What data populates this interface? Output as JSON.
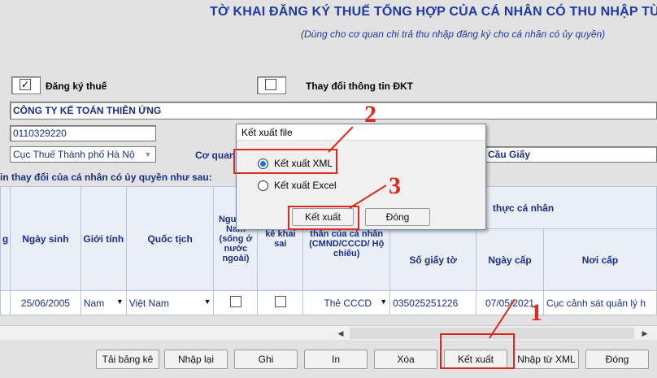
{
  "header": {
    "title": "TỜ KHAI ĐĂNG KÝ THUẾ TỔNG HỢP CỦA CÁ NHÂN CÓ THU NHẬP TỪ",
    "subtitle": "(Dùng cho cơ quan chi trả thu nhập đăng ký cho cá nhân có ủy quyền)"
  },
  "form": {
    "dang_ky_thue": {
      "label": "Đăng ký thuế",
      "checked": true,
      "mark": "✓"
    },
    "thay_doi": {
      "label": "Thay đổi thông tin ĐKT",
      "checked": false
    },
    "company_name": "CÔNG TY KẾ TOÁN THIÊN ỨNG",
    "tax_code": "0110329220",
    "tax_office": "Cục Thuế Thành phố Hà Nộ",
    "co_quan_label": "Cơ quan",
    "co_quan_value": "Cầu Giấy",
    "section_label": "in thay đổi của cá nhân có ủy quyền như sau:"
  },
  "table": {
    "headers": {
      "col0": "g",
      "ngay_sinh": "Ngày sinh",
      "gioi_tinh": "Giới tính",
      "quoc_tich": "Quốc tịch",
      "nguoi_viet_nam": "Ngư Việ Nam (sống ở nước ngoài)",
      "ke_khai_sai": "kê khai sai",
      "loai_giay_to": "Loại giấy tờ tùy thân của cá nhân (CMND/CCCD/ Hộ chiếu)",
      "so_giay_to": "Số giấy tờ",
      "ngay_cap": "Ngày cấp",
      "noi_cap": "Nơi cấp",
      "group": "thực cá nhân"
    },
    "row": {
      "ngay_sinh": "25/06/2005",
      "gioi_tinh": "Nam",
      "quoc_tich": "Việt Nam",
      "loai_giay_to": "Thẻ CCCD",
      "so_giay_to": "035025251226",
      "ngay_cap": "07/05/2021",
      "noi_cap": "Cục cảnh sát quản lý h"
    }
  },
  "buttons": {
    "tai_bang_ke": "Tải bảng kê",
    "nhap_lai": "Nhập lại",
    "ghi": "Ghi",
    "in": "In",
    "xoa": "Xóa",
    "ket_xuat": "Kết xuất",
    "nhap_tu_xml": "Nhập từ XML",
    "dong": "Đóng"
  },
  "dialog": {
    "title": "Kết xuất file",
    "option_xml": "Kết xuất XML",
    "option_excel": "Kết xuất Excel",
    "selected": "Kết xuất XML",
    "ok_label": "Kết xuất",
    "cancel_label": "Đóng"
  },
  "annotations": {
    "step1": "1",
    "step2": "2",
    "step3": "3",
    "color": "#e0271d"
  }
}
